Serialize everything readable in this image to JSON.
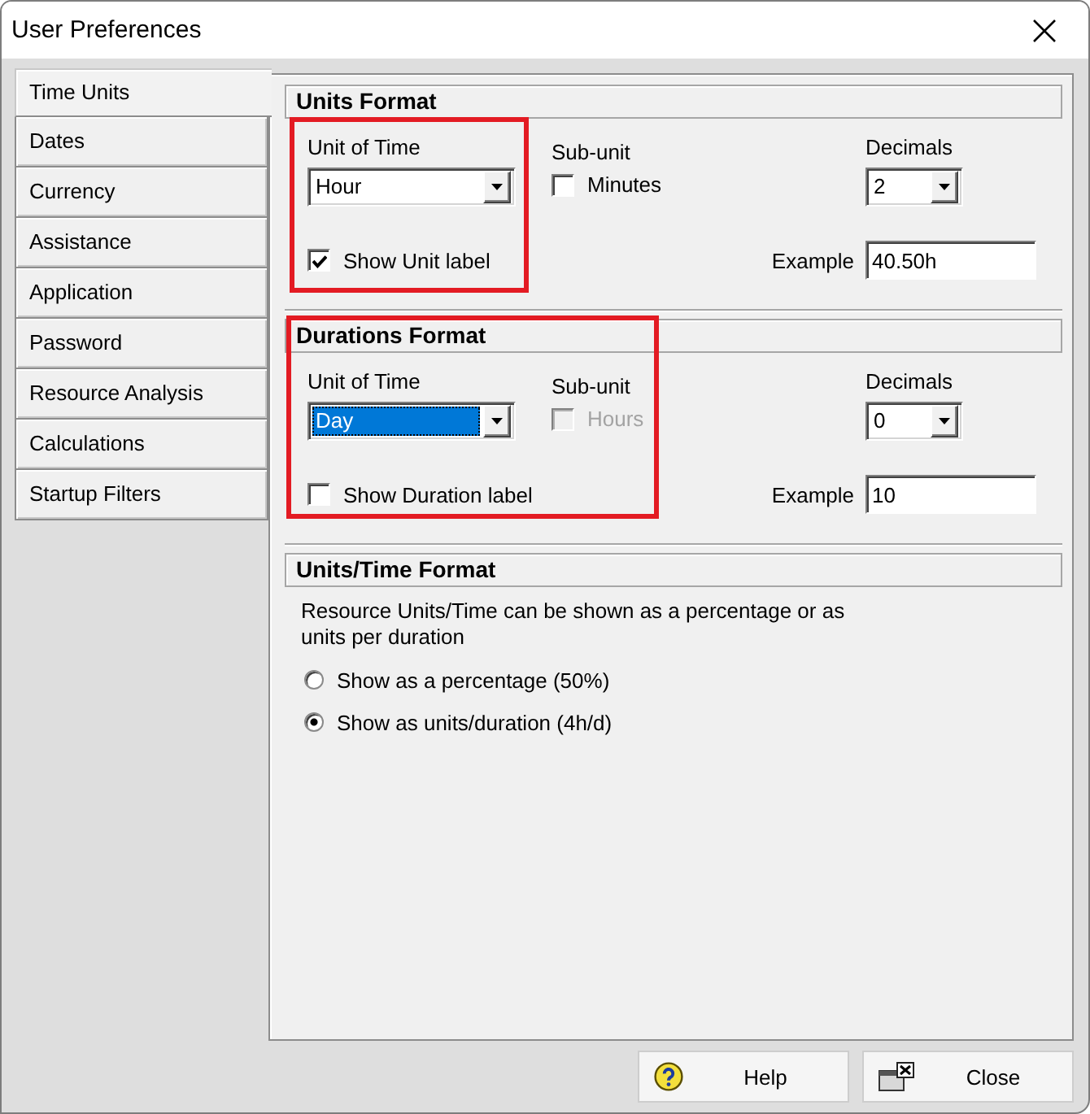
{
  "window": {
    "title": "User Preferences"
  },
  "sidebar": {
    "items": [
      {
        "label": "Time Units",
        "selected": true
      },
      {
        "label": "Dates",
        "selected": false
      },
      {
        "label": "Currency",
        "selected": false
      },
      {
        "label": "Assistance",
        "selected": false
      },
      {
        "label": "Application",
        "selected": false
      },
      {
        "label": "Password",
        "selected": false
      },
      {
        "label": "Resource Analysis",
        "selected": false
      },
      {
        "label": "Calculations",
        "selected": false
      },
      {
        "label": "Startup Filters",
        "selected": false
      }
    ]
  },
  "sections": [
    {
      "kind": "format",
      "title": "Units Format",
      "highlighted": true,
      "unit": {
        "label": "Unit of Time",
        "value": "Hour",
        "focused": false
      },
      "subunit": {
        "label": "Sub-unit",
        "option": "Minutes",
        "checked": false,
        "disabled": false
      },
      "decimals": {
        "label": "Decimals",
        "value": "2"
      },
      "show_label": {
        "label": "Show Unit label",
        "checked": true
      },
      "example": {
        "label": "Example",
        "value": "40.50h"
      }
    },
    {
      "kind": "format",
      "title": "Durations Format",
      "highlighted": true,
      "unit": {
        "label": "Unit of Time",
        "value": "Day",
        "focused": true
      },
      "subunit": {
        "label": "Sub-unit",
        "option": "Hours",
        "checked": false,
        "disabled": true
      },
      "decimals": {
        "label": "Decimals",
        "value": "0"
      },
      "show_label": {
        "label": "Show Duration label",
        "checked": false
      },
      "example": {
        "label": "Example",
        "value": "10"
      }
    },
    {
      "kind": "choice",
      "title": "Units/Time Format",
      "description": "Resource Units/Time can be shown as a percentage or as units per duration",
      "options": [
        {
          "label": "Show as a percentage (50%)",
          "selected": false
        },
        {
          "label": "Show as units/duration (4h/d)",
          "selected": true
        }
      ]
    }
  ],
  "buttons": [
    {
      "kind": "help",
      "label": "Help"
    },
    {
      "kind": "close",
      "label": "Close"
    }
  ]
}
